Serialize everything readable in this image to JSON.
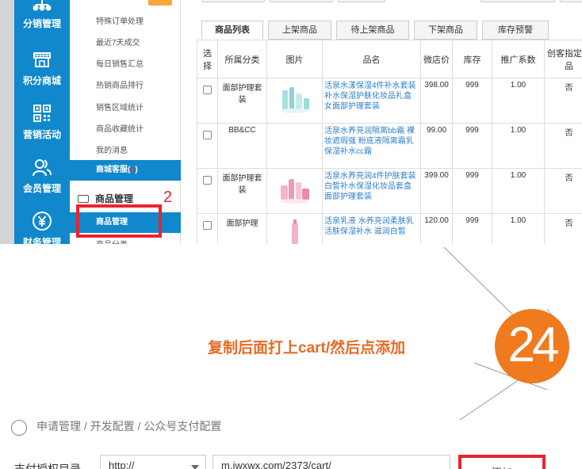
{
  "nav": {
    "items": [
      {
        "label": "分销管理",
        "icon": "hierarchy-icon"
      },
      {
        "label": "积分商城",
        "icon": "storefront-icon"
      },
      {
        "label": "营销活动",
        "icon": "qr-code-icon"
      },
      {
        "label": "会员管理",
        "icon": "users-icon"
      },
      {
        "label": "财务管理",
        "icon": "yuan-icon"
      }
    ]
  },
  "submenu": {
    "items": [
      "特殊订单处理",
      "最近7天成交",
      "每日销售汇总",
      "热销商品排行",
      "销售区域统计",
      "商品收藏统计",
      "我的消息"
    ],
    "service": "商城客服",
    "service_suffix": "(",
    "service_dot": "●",
    "service_close": ")",
    "section": "商品管理",
    "active": "商品管理",
    "next": "商品分类"
  },
  "annotation": {
    "step_number": "2",
    "badge_number": "24"
  },
  "tabs": [
    "商品列表",
    "上架商品",
    "待上架商品",
    "下架商品",
    "库存预警"
  ],
  "table": {
    "headers": [
      "选择",
      "所属分类",
      "图片",
      "品名",
      "微店价",
      "库存",
      "推广系数",
      "创客指定商品"
    ],
    "rows": [
      {
        "category": "面部护理套装",
        "name": "活泉水漾保湿4件补水套装 补水保湿护肤化妆品礼盒女面部护理套装",
        "price": "398.00",
        "stock": "999",
        "coef": "1.00",
        "maker": "否",
        "thumb": "teal"
      },
      {
        "category": "BB&CC",
        "name": "活泉水养亮润隔离bb霜 裸妆遮瑕强 粉底液隔离霜乳保湿补水cc霜",
        "price": "99.00",
        "stock": "999",
        "coef": "1.00",
        "maker": "否",
        "thumb": "none"
      },
      {
        "category": "面部护理套装",
        "name": "活泉水养亮润4件护肤套装 白皙补水保湿化妆品套盒 面部护理套装",
        "price": "399.00",
        "stock": "999",
        "coef": "1.00",
        "maker": "否",
        "thumb": "pink"
      },
      {
        "category": "面部护理",
        "name": "活泉乳液 水养亮润柔肤乳 活肤保湿补水 滋润白皙",
        "price": "120.00",
        "stock": "999",
        "coef": "1.00",
        "maker": "否",
        "thumb": "pink2"
      }
    ]
  },
  "instruction": "复制后面打上cart/然后点添加",
  "bottom": {
    "breadcrumb": "申请管理 / 开发配置 / 公众号支付配置",
    "field_label": "支付授权目录",
    "protocol": "http://",
    "url": "m.jwxwx.com/2373/cart/",
    "add_label": "添加"
  },
  "colors": {
    "brand": "#1188cc",
    "highlight": "#e8252f",
    "instruction": "#e86a25",
    "badge": "#f07a1e",
    "link": "#2d7fc9"
  }
}
